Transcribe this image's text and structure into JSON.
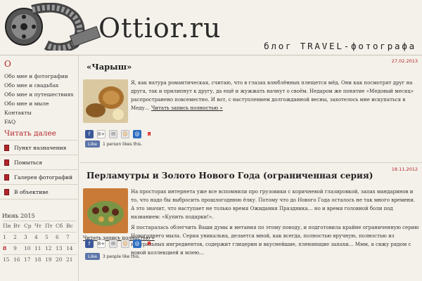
{
  "header": {
    "site_title": "Ottior.ru",
    "tagline": "блог TRAVEL-фотографа"
  },
  "sidebar": {
    "heading": "О",
    "links": [
      {
        "label": "Обо мне и фотографии"
      },
      {
        "label": "Обо мне и свадьбах"
      },
      {
        "label": "Обо мне и путешествиях"
      },
      {
        "label": "Обо мне и мыле"
      },
      {
        "label": "Контакты"
      },
      {
        "label": "FAQ"
      }
    ],
    "read_more": "Читать далее",
    "categories": [
      {
        "label": "Пункт назначения"
      },
      {
        "label": "Помыться"
      },
      {
        "label": "Галерея фотографий"
      },
      {
        "label": "В объективе"
      }
    ],
    "calendar": {
      "title": "Июнь 2015",
      "days": [
        "Пн",
        "Вт",
        "Ср",
        "Чт",
        "Пт",
        "Сб",
        "Вс"
      ],
      "weeks": [
        [
          "1",
          "2",
          "3",
          "4",
          "5",
          "6",
          "7"
        ],
        [
          "8",
          "9",
          "10",
          "11",
          "12",
          "13",
          "14"
        ],
        [
          "15",
          "16",
          "17",
          "18",
          "19",
          "20",
          "21"
        ]
      ]
    }
  },
  "posts": [
    {
      "title": "«Чарыш»",
      "date": "27.02.2013",
      "text": "Я, как натура романтическая, считаю, что в глазах влюблённых плещется мёд. Они как посмотрят друг на друга, так и прилипнут к другу, да ещё и жужжать начнут о своём. Недаром же понятие «Медовый месяц» распространено повсеместно. И вот, с наступлением долгожданной весны, захотелось мне искупаться в Меду…",
      "more": "Читать запись полностью »",
      "likes": "1 person likes this."
    },
    {
      "title": "Перламутры и Золото Нового Года (ограниченная серия)",
      "date": "18.11.2012",
      "paragraphs": [
        "На просторах интернета уже все вспомнили про грузовики с коричневой глазировкой, запах мандаринов и то, что надо бы выбросить прошлогоднюю ёлку. Потому что до Нового Года осталось не так много времени. А это значит, что наступает не только время Ожидания Праздника… но и время головной боли под названием: «Купить подарки!».",
        "Я постаралась облегчить Ваши думы и метания по этому поводу, и подготовила крайне ограниченную серию Новогоднего мыла. Серия уникальна, делается мной, как всегда, полностью вручную, полностью из натуральных ингредиентов, содержит глицерин и вкуснейшие, пленяющие запахи… Ммм, я сижу рядом с новой коллекцией и млею…"
      ],
      "more": "Читать запись полностью »",
      "likes": "3 people like this."
    }
  ],
  "share": {
    "like_label": "Like",
    "gplus": "8+",
    "yandex": "Я"
  }
}
